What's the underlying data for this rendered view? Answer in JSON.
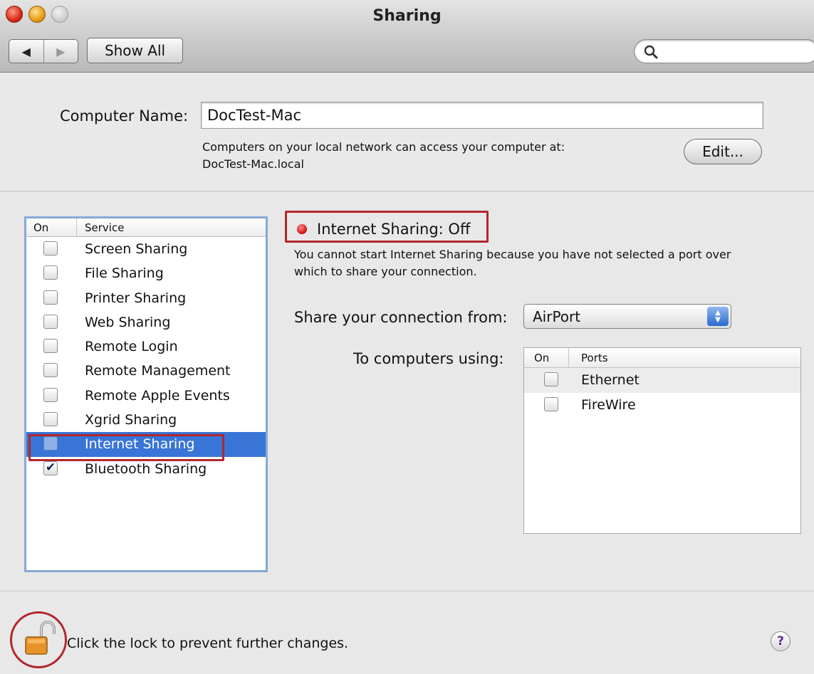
{
  "window": {
    "title": "Sharing"
  },
  "toolbar": {
    "back_icon": "◀",
    "forward_icon": "▶",
    "show_all_label": "Show All",
    "search": {
      "value": "",
      "placeholder": ""
    }
  },
  "computer_name": {
    "label": "Computer Name:",
    "value": "DocTest-Mac",
    "desc_line1": "Computers on your local network can access your computer at:",
    "desc_line2": "DocTest-Mac.local",
    "edit_label": "Edit..."
  },
  "services": {
    "header_on": "On",
    "header_service": "Service",
    "items": [
      {
        "label": "Screen Sharing",
        "checked": false
      },
      {
        "label": "File Sharing",
        "checked": false
      },
      {
        "label": "Printer Sharing",
        "checked": false
      },
      {
        "label": "Web Sharing",
        "checked": false
      },
      {
        "label": "Remote Login",
        "checked": false
      },
      {
        "label": "Remote Management",
        "checked": false
      },
      {
        "label": "Remote Apple Events",
        "checked": false
      },
      {
        "label": "Xgrid Sharing",
        "checked": false
      },
      {
        "label": "Internet Sharing",
        "checked": false,
        "selected": true
      },
      {
        "label": "Bluetooth Sharing",
        "checked": true
      }
    ]
  },
  "detail": {
    "status_text": "Internet Sharing: Off",
    "status_color": "#d0161a",
    "warning_line1": "You cannot start Internet Sharing because you have not selected a port over",
    "warning_line2": "which to share your connection.",
    "share_from_label": "Share your connection from:",
    "share_from_value": "AirPort",
    "to_label": "To computers using:",
    "ports_header_on": "On",
    "ports_header_ports": "Ports",
    "ports": [
      {
        "label": "Ethernet",
        "checked": false
      },
      {
        "label": "FireWire",
        "checked": false
      }
    ]
  },
  "footer": {
    "lock_text": "Click the lock to prevent further changes.",
    "help_label": "?"
  },
  "colors": {
    "selection": "#3875d7",
    "highlight_border": "#b3262b",
    "list_focus_border": "#86a9d6"
  }
}
